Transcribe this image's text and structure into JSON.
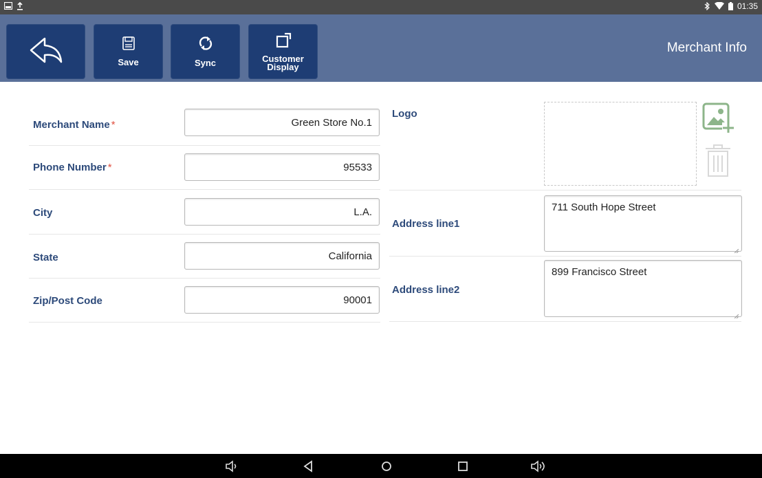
{
  "status_bar": {
    "time": "01:35",
    "icons": [
      "screenshot-icon",
      "upload-icon",
      "bluetooth-icon",
      "wifi-icon",
      "battery-icon"
    ]
  },
  "toolbar": {
    "back_icon": "back-arrow-icon",
    "save_label": "Save",
    "sync_label": "Sync",
    "customer_display_label_line1": "Customer",
    "customer_display_label_line2": "Display",
    "title": "Merchant Info"
  },
  "form": {
    "merchant_name": {
      "label": "Merchant Name",
      "required": "*",
      "value": "Green Store No.1"
    },
    "phone_number": {
      "label": "Phone Number",
      "required": "*",
      "value": "95533"
    },
    "city": {
      "label": "City",
      "value": "L.A."
    },
    "state": {
      "label": "State",
      "value": "California"
    },
    "zip": {
      "label": "Zip/Post Code",
      "value": "90001"
    },
    "logo": {
      "label": "Logo",
      "add_icon": "add-image-icon",
      "delete_icon": "trash-icon"
    },
    "address1": {
      "label": "Address line1",
      "value": "711 South Hope Street"
    },
    "address2": {
      "label": "Address line2",
      "value": "899 Francisco Street"
    }
  },
  "nav_bar": {
    "icons": [
      "volume-down-icon",
      "back-icon",
      "home-icon",
      "recents-icon",
      "volume-up-icon"
    ]
  },
  "colors": {
    "header": "#5a7099",
    "toolbar_button": "#1e3d74",
    "label": "#2d4a7a",
    "required": "#e05040",
    "logo_icon": "#8db58a"
  }
}
